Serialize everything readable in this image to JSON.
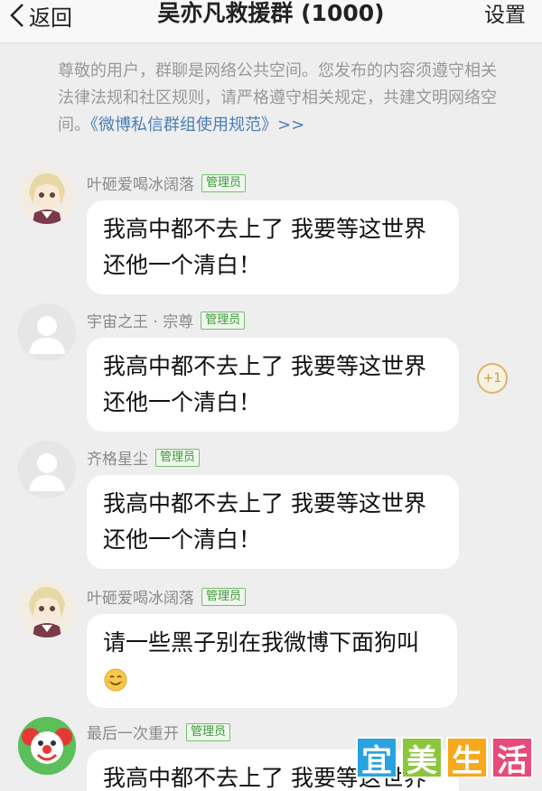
{
  "header": {
    "back_label": "返回",
    "title": "吴亦凡救援群 (1000)",
    "settings_label": "设置"
  },
  "notice": {
    "text": "尊敬的用户，群聊是网络公共空间。您发布的内容须遵守相关法律法规和社区规则，请严格遵守相关规定，共建文明网络空间。",
    "link": "《微博私信群组使用规范》>>"
  },
  "messages": [
    {
      "sender": "叶砸爱喝冰阔落",
      "badge": "管理员",
      "text": "我高中都不去上了 我要等这世界还他一个清白！",
      "avatar": "anime-girl-avatar"
    },
    {
      "sender": "宇宙之王 · 宗尊",
      "badge": "管理员",
      "text": "我高中都不去上了 我要等这世界还他一个清白！",
      "avatar": "default-avatar",
      "reaction": "+1"
    },
    {
      "sender": "齐格星尘",
      "badge": "管理员",
      "text": "我高中都不去上了 我要等这世界还他一个清白！",
      "avatar": "default-avatar"
    },
    {
      "sender": "叶砸爱喝冰阔落",
      "badge": "管理员",
      "text": "请一些黑子别在我微博下面狗叫",
      "emoji": "smile-emoji",
      "avatar": "anime-girl-avatar"
    },
    {
      "sender": "最后一次重开",
      "badge": "管理员",
      "text": "我高中都不去上了 我要等这世界还他一个清白！",
      "avatar": "clown-avatar"
    }
  ],
  "watermark": [
    "宜",
    "美",
    "生",
    "活"
  ],
  "colors": {
    "badge_green": "#3f9a3c",
    "link_blue": "#4a7fb8",
    "background": "#eeeeee"
  }
}
